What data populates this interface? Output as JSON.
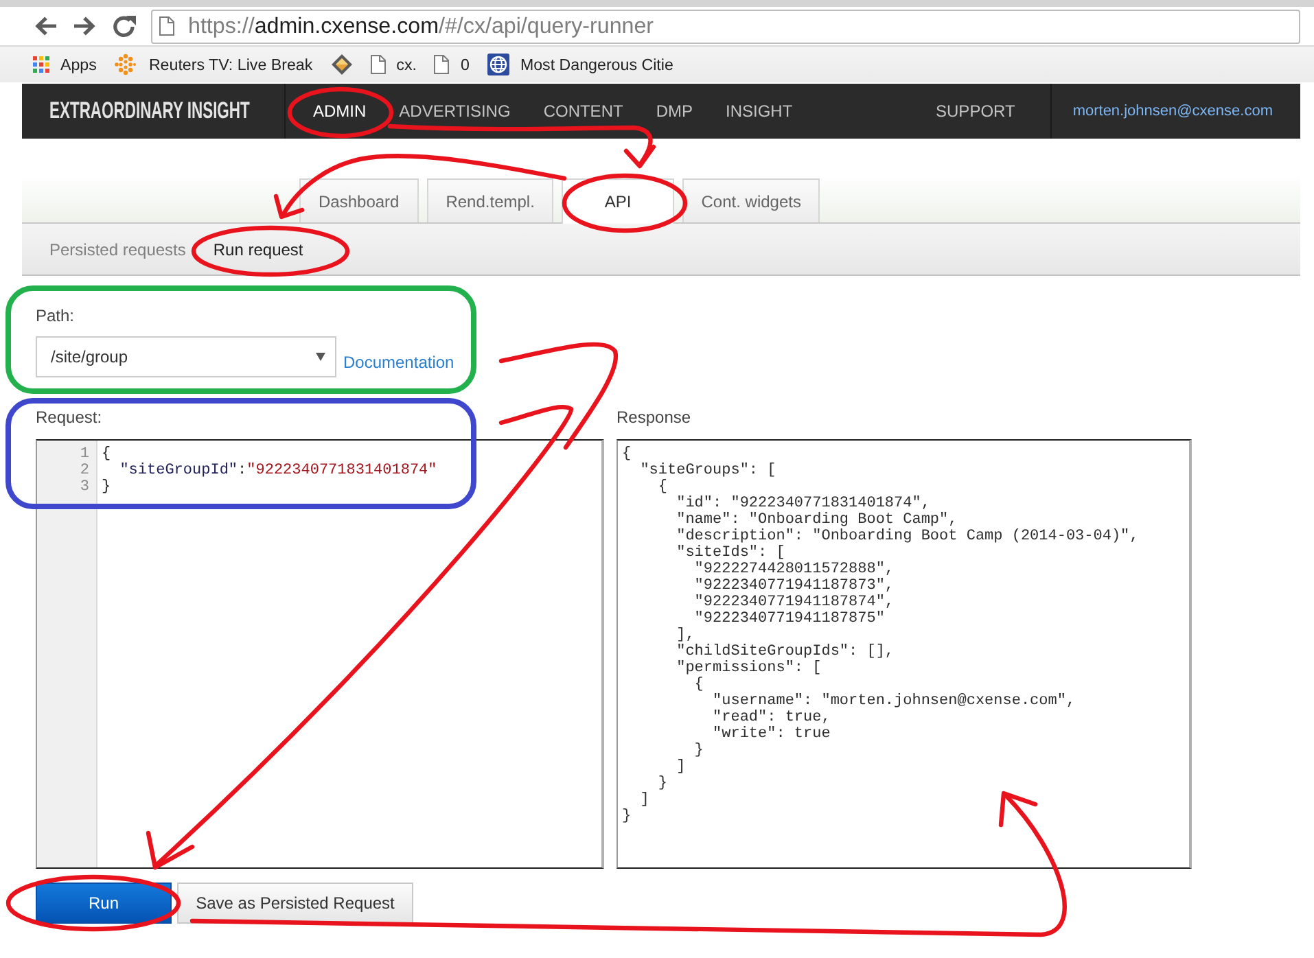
{
  "browser": {
    "url": {
      "scheme": "https://",
      "host": "admin.cxense.com",
      "path": "/#/cx/api/query-runner"
    },
    "bookmarks": [
      {
        "kind": "apps",
        "label": "Apps"
      },
      {
        "kind": "dots",
        "label": "Reuters TV: Live Break"
      },
      {
        "kind": "diamond"
      },
      {
        "kind": "page",
        "label": "cx."
      },
      {
        "kind": "page",
        "label": "0"
      },
      {
        "kind": "globe",
        "label": "Most Dangerous Citie"
      }
    ]
  },
  "navbar": {
    "brand": "EXTRAORDINARY INSIGHT",
    "items": [
      {
        "label": "ADMIN",
        "selected": true
      },
      {
        "label": "ADVERTISING",
        "selected": false
      },
      {
        "label": "CONTENT",
        "selected": false
      },
      {
        "label": "DMP",
        "selected": false
      },
      {
        "label": "INSIGHT",
        "selected": false
      }
    ],
    "support": "SUPPORT",
    "user": "morten.johnsen@cxense.com"
  },
  "tabs": [
    {
      "label": "Dashboard",
      "selected": false
    },
    {
      "label": "Rend.templ.",
      "selected": false
    },
    {
      "label": "API",
      "selected": true
    },
    {
      "label": "Cont. widgets",
      "selected": false
    }
  ],
  "subtabs": [
    {
      "label": "Persisted requests",
      "selected": false
    },
    {
      "label": "Run request",
      "selected": true
    }
  ],
  "path": {
    "label": "Path:",
    "value": "/site/group",
    "link": "Documentation"
  },
  "request": {
    "label": "Request:",
    "lines": [
      {
        "number": "1",
        "tokens": [
          {
            "kind": "punct",
            "text": "{"
          }
        ]
      },
      {
        "number": "2",
        "tokens": [
          {
            "kind": "key",
            "text": "  \"siteGroupId\""
          },
          {
            "kind": "punct",
            "text": ":"
          },
          {
            "kind": "string",
            "text": "\"9222340771831401874\""
          }
        ]
      },
      {
        "number": "3",
        "tokens": [
          {
            "kind": "punct",
            "text": "}"
          }
        ]
      }
    ]
  },
  "response": {
    "label": "Response",
    "lines": [
      "{",
      "  \"siteGroups\": [",
      "    {",
      "      \"id\": \"9222340771831401874\",",
      "      \"name\": \"Onboarding Boot Camp\",",
      "      \"description\": \"Onboarding Boot Camp (2014-03-04)\",",
      "      \"siteIds\": [",
      "        \"9222274428011572888\",",
      "        \"9222340771941187873\",",
      "        \"9222340771941187874\",",
      "        \"9222340771941187875\"",
      "      ],",
      "      \"childSiteGroupIds\": [],",
      "      \"permissions\": [",
      "        {",
      "          \"username\": \"morten.johnsen@cxense.com\",",
      "          \"read\": true,",
      "          \"write\": true",
      "        }",
      "      ]",
      "    }",
      "  ]",
      "}"
    ]
  },
  "buttons": [
    {
      "kind": "primary",
      "label": "Run"
    },
    {
      "kind": "secondary",
      "label": "Save as Persisted Request"
    }
  ]
}
